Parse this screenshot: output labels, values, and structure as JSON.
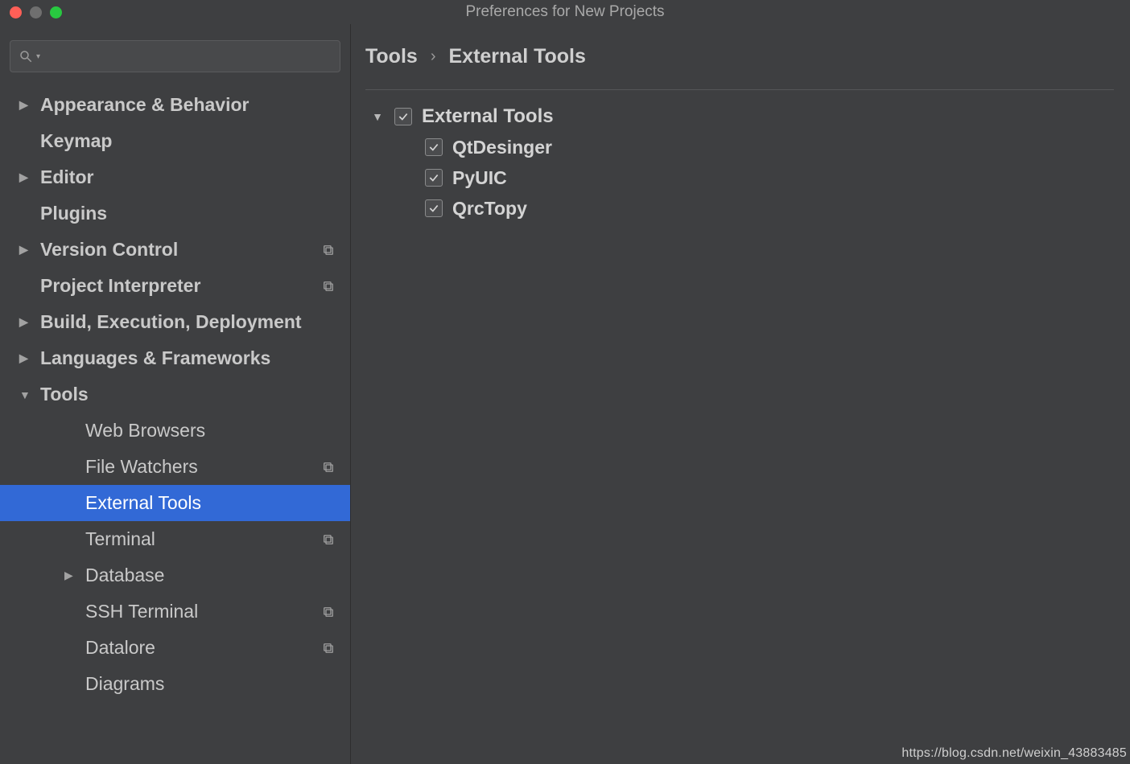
{
  "window": {
    "title": "Preferences for New Projects"
  },
  "search": {
    "placeholder": ""
  },
  "sidebar": {
    "items": [
      {
        "label": "Appearance & Behavior",
        "expandable": true,
        "expanded": false,
        "indent": 0,
        "hasCopy": false
      },
      {
        "label": "Keymap",
        "expandable": false,
        "indent": 0,
        "hasCopy": false
      },
      {
        "label": "Editor",
        "expandable": true,
        "expanded": false,
        "indent": 0,
        "hasCopy": false
      },
      {
        "label": "Plugins",
        "expandable": false,
        "indent": 0,
        "hasCopy": false
      },
      {
        "label": "Version Control",
        "expandable": true,
        "expanded": false,
        "indent": 0,
        "hasCopy": true
      },
      {
        "label": "Project Interpreter",
        "expandable": false,
        "indent": 0,
        "hasCopy": true
      },
      {
        "label": "Build, Execution, Deployment",
        "expandable": true,
        "expanded": false,
        "indent": 0,
        "hasCopy": false
      },
      {
        "label": "Languages & Frameworks",
        "expandable": true,
        "expanded": false,
        "indent": 0,
        "hasCopy": false
      },
      {
        "label": "Tools",
        "expandable": true,
        "expanded": true,
        "indent": 0,
        "hasCopy": false
      },
      {
        "label": "Web Browsers",
        "expandable": false,
        "indent": 1,
        "hasCopy": false
      },
      {
        "label": "File Watchers",
        "expandable": false,
        "indent": 1,
        "hasCopy": true
      },
      {
        "label": "External Tools",
        "expandable": false,
        "indent": 1,
        "hasCopy": false,
        "selected": true
      },
      {
        "label": "Terminal",
        "expandable": false,
        "indent": 1,
        "hasCopy": true
      },
      {
        "label": "Database",
        "expandable": true,
        "expanded": false,
        "indent": 1,
        "hasCopy": false
      },
      {
        "label": "SSH Terminal",
        "expandable": false,
        "indent": 1,
        "hasCopy": true
      },
      {
        "label": "Datalore",
        "expandable": false,
        "indent": 1,
        "hasCopy": true
      },
      {
        "label": "Diagrams",
        "expandable": false,
        "indent": 1,
        "hasCopy": false
      }
    ]
  },
  "breadcrumb": {
    "root": "Tools",
    "sep": "›",
    "current": "External Tools"
  },
  "externalTools": {
    "groupName": "External Tools",
    "groupChecked": true,
    "tools": [
      {
        "name": "QtDesinger",
        "checked": true
      },
      {
        "name": "PyUIC",
        "checked": true
      },
      {
        "name": "QrcTopy",
        "checked": true
      }
    ]
  },
  "watermark": "https://blog.csdn.net/weixin_43883485"
}
